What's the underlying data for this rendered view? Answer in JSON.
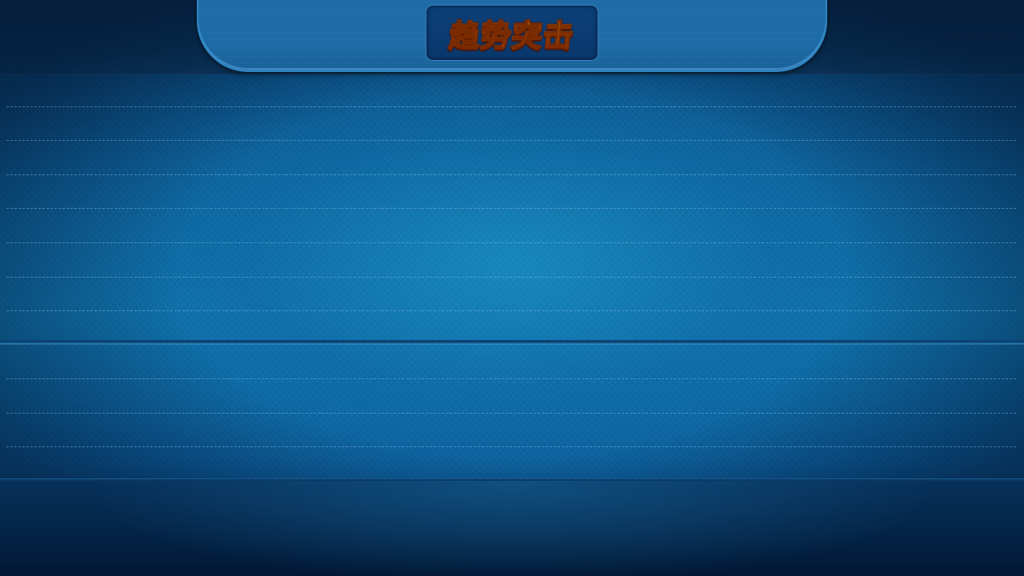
{
  "game": {
    "title": "趋势突击"
  },
  "colors": {
    "background_top": "#06325e",
    "background_center": "#178abe",
    "header_tab": "#1b6ba7",
    "title_plate": "#0c3f78",
    "title_gradient_top": "#ffe23a",
    "title_gradient_bottom": "#ff6a08",
    "dotted_line": "#96cdf0",
    "bottom_area": "#042447"
  },
  "board": {
    "upper_row_count": 7,
    "lower_row_count": 3
  }
}
